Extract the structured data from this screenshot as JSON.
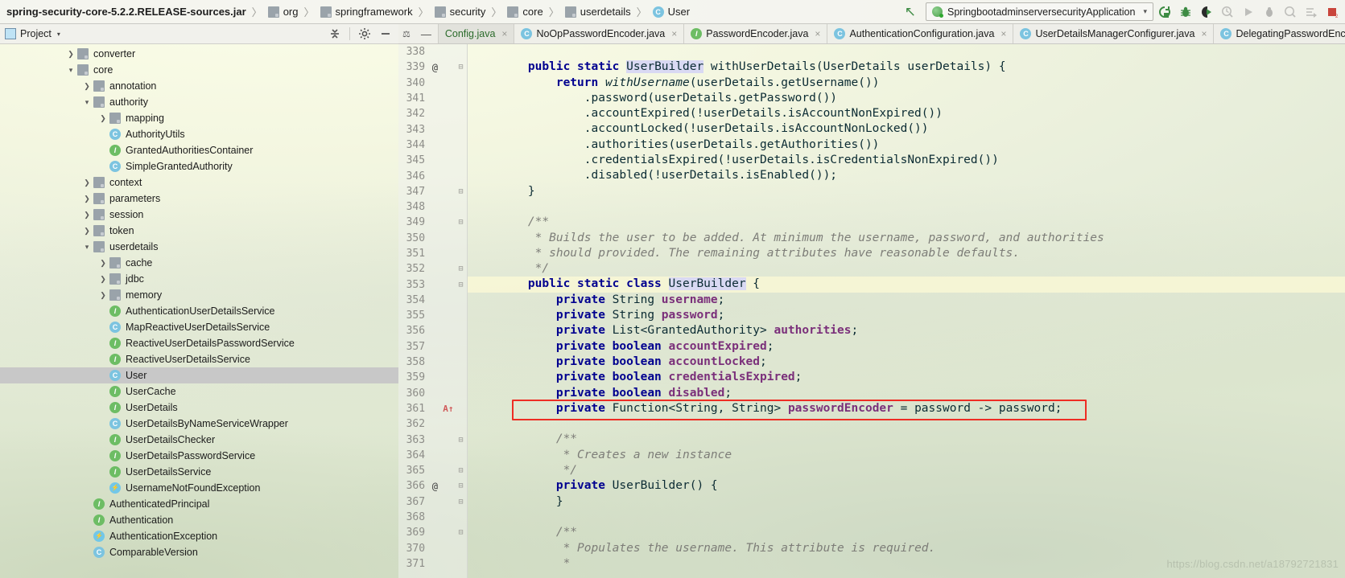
{
  "breadcrumb": {
    "root": "spring-security-core-5.2.2.RELEASE-sources.jar",
    "items": [
      {
        "label": "org",
        "icon": "folder-icon"
      },
      {
        "label": "springframework",
        "icon": "folder-icon"
      },
      {
        "label": "security",
        "icon": "folder-icon"
      },
      {
        "label": "core",
        "icon": "folder-icon"
      },
      {
        "label": "userdetails",
        "icon": "folder-icon"
      },
      {
        "label": "User",
        "icon": "class-icon"
      }
    ],
    "separator": "〉"
  },
  "toolbar": {
    "back_icon": "back-arrow-icon",
    "run_config": {
      "name": "SpringbootadminserversecurityApplication",
      "icon": "spring-boot-icon",
      "chevron": "⌄"
    },
    "buttons": [
      {
        "name": "rerun-button",
        "icon": "rerun-icon",
        "enabled": true
      },
      {
        "name": "debug-button",
        "icon": "bug-icon",
        "enabled": true
      },
      {
        "name": "run-with-coverage-button",
        "icon": "coverage-icon",
        "enabled": true
      },
      {
        "name": "profile-button",
        "icon": "profile-icon",
        "enabled": false
      },
      {
        "name": "resume-program-button",
        "icon": "play-icon",
        "enabled": false
      },
      {
        "name": "attach-debugger-button",
        "icon": "attach-icon",
        "enabled": false
      },
      {
        "name": "profiler-button",
        "icon": "profiler-icon",
        "enabled": false
      },
      {
        "name": "step-over-button",
        "icon": "step-over-icon",
        "enabled": false
      },
      {
        "name": "stop-button",
        "icon": "stop-icon",
        "enabled": true
      }
    ]
  },
  "sidebar": {
    "title": "Project",
    "title_icon": "project-view-icon",
    "title_caret": "▾",
    "collapse_all_icon": "collapse-all-icon",
    "settings_icon": "gear-icon",
    "hide_icon": "hide-icon",
    "tree": [
      {
        "label": "converter",
        "indent": 1,
        "arrow": "collapsed",
        "icon": "folder-icon",
        "selected": false
      },
      {
        "label": "core",
        "indent": 1,
        "arrow": "expanded",
        "icon": "folder-icon",
        "selected": false
      },
      {
        "label": "annotation",
        "indent": 2,
        "arrow": "collapsed",
        "icon": "folder-icon",
        "selected": false
      },
      {
        "label": "authority",
        "indent": 2,
        "arrow": "expanded",
        "icon": "folder-icon",
        "selected": false
      },
      {
        "label": "mapping",
        "indent": 3,
        "arrow": "collapsed",
        "icon": "folder-icon",
        "selected": false
      },
      {
        "label": "AuthorityUtils",
        "indent": 3,
        "arrow": "none",
        "icon": "class-icon",
        "selected": false
      },
      {
        "label": "GrantedAuthoritiesContainer",
        "indent": 3,
        "arrow": "none",
        "icon": "interface-icon",
        "selected": false
      },
      {
        "label": "SimpleGrantedAuthority",
        "indent": 3,
        "arrow": "none",
        "icon": "class-icon",
        "selected": false
      },
      {
        "label": "context",
        "indent": 2,
        "arrow": "collapsed",
        "icon": "folder-icon",
        "selected": false
      },
      {
        "label": "parameters",
        "indent": 2,
        "arrow": "collapsed",
        "icon": "folder-icon",
        "selected": false
      },
      {
        "label": "session",
        "indent": 2,
        "arrow": "collapsed",
        "icon": "folder-icon",
        "selected": false
      },
      {
        "label": "token",
        "indent": 2,
        "arrow": "collapsed",
        "icon": "folder-icon",
        "selected": false
      },
      {
        "label": "userdetails",
        "indent": 2,
        "arrow": "expanded",
        "icon": "folder-icon",
        "selected": false
      },
      {
        "label": "cache",
        "indent": 3,
        "arrow": "collapsed",
        "icon": "folder-icon",
        "selected": false
      },
      {
        "label": "jdbc",
        "indent": 3,
        "arrow": "collapsed",
        "icon": "folder-icon",
        "selected": false
      },
      {
        "label": "memory",
        "indent": 3,
        "arrow": "collapsed",
        "icon": "folder-icon",
        "selected": false
      },
      {
        "label": "AuthenticationUserDetailsService",
        "indent": 3,
        "arrow": "none",
        "icon": "interface-icon",
        "selected": false
      },
      {
        "label": "MapReactiveUserDetailsService",
        "indent": 3,
        "arrow": "none",
        "icon": "class-icon",
        "selected": false
      },
      {
        "label": "ReactiveUserDetailsPasswordService",
        "indent": 3,
        "arrow": "none",
        "icon": "interface-icon",
        "selected": false
      },
      {
        "label": "ReactiveUserDetailsService",
        "indent": 3,
        "arrow": "none",
        "icon": "interface-icon",
        "selected": false
      },
      {
        "label": "User",
        "indent": 3,
        "arrow": "none",
        "icon": "class-icon",
        "selected": true
      },
      {
        "label": "UserCache",
        "indent": 3,
        "arrow": "none",
        "icon": "interface-icon",
        "selected": false
      },
      {
        "label": "UserDetails",
        "indent": 3,
        "arrow": "none",
        "icon": "interface-icon",
        "selected": false
      },
      {
        "label": "UserDetailsByNameServiceWrapper",
        "indent": 3,
        "arrow": "none",
        "icon": "class-icon",
        "selected": false
      },
      {
        "label": "UserDetailsChecker",
        "indent": 3,
        "arrow": "none",
        "icon": "interface-icon",
        "selected": false
      },
      {
        "label": "UserDetailsPasswordService",
        "indent": 3,
        "arrow": "none",
        "icon": "interface-icon",
        "selected": false
      },
      {
        "label": "UserDetailsService",
        "indent": 3,
        "arrow": "none",
        "icon": "interface-icon",
        "selected": false
      },
      {
        "label": "UsernameNotFoundException",
        "indent": 3,
        "arrow": "none",
        "icon": "exception-icon",
        "selected": false
      },
      {
        "label": "AuthenticatedPrincipal",
        "indent": 2,
        "arrow": "none",
        "icon": "interface-icon",
        "selected": false
      },
      {
        "label": "Authentication",
        "indent": 2,
        "arrow": "none",
        "icon": "interface-icon",
        "selected": false
      },
      {
        "label": "AuthenticationException",
        "indent": 2,
        "arrow": "none",
        "icon": "exception-icon",
        "selected": false
      },
      {
        "label": "ComparableVersion",
        "indent": 2,
        "arrow": "none",
        "icon": "class-icon",
        "selected": false
      }
    ]
  },
  "tabs": {
    "pin_icon": "pin-icon",
    "minimize_icon": "—",
    "items": [
      {
        "label": "Config.java",
        "icon": "none",
        "active": true,
        "close": "×"
      },
      {
        "label": "NoOpPasswordEncoder.java",
        "icon": "class-icon",
        "active": false,
        "close": "×"
      },
      {
        "label": "PasswordEncoder.java",
        "icon": "interface-icon",
        "active": false,
        "close": "×"
      },
      {
        "label": "AuthenticationConfiguration.java",
        "icon": "class-icon",
        "active": false,
        "close": "×"
      },
      {
        "label": "UserDetailsManagerConfigurer.java",
        "icon": "class-icon",
        "active": false,
        "close": "×"
      },
      {
        "label": "DelegatingPasswordEncoder.java",
        "icon": "class-icon",
        "active": false,
        "close": "×"
      }
    ]
  },
  "editor": {
    "first_visible_line": 338,
    "lines": [
      {
        "num": 338,
        "at": "",
        "warn": "",
        "fold": "",
        "highlight": false,
        "partial": true,
        "html": ""
      },
      {
        "num": 339,
        "at": "@",
        "warn": "",
        "fold": "-",
        "highlight": false,
        "html": "    <span class='kw'>public static</span> <span class='sel'>UserBuilder</span> withUserDetails(UserDetails userDetails) {"
      },
      {
        "num": 340,
        "at": "",
        "warn": "",
        "fold": "",
        "highlight": false,
        "html": "        <span class='kw'>return</span> <span class='mth'>withUsername</span>(userDetails.getUsername())"
      },
      {
        "num": 341,
        "at": "",
        "warn": "",
        "fold": "",
        "highlight": false,
        "html": "            .password(userDetails.getPassword())"
      },
      {
        "num": 342,
        "at": "",
        "warn": "",
        "fold": "",
        "highlight": false,
        "html": "            .accountExpired(!userDetails.isAccountNonExpired())"
      },
      {
        "num": 343,
        "at": "",
        "warn": "",
        "fold": "",
        "highlight": false,
        "html": "            .accountLocked(!userDetails.isAccountNonLocked())"
      },
      {
        "num": 344,
        "at": "",
        "warn": "",
        "fold": "",
        "highlight": false,
        "html": "            .authorities(userDetails.getAuthorities())"
      },
      {
        "num": 345,
        "at": "",
        "warn": "",
        "fold": "",
        "highlight": false,
        "html": "            .credentialsExpired(!userDetails.isCredentialsNonExpired())"
      },
      {
        "num": 346,
        "at": "",
        "warn": "",
        "fold": "",
        "highlight": false,
        "html": "            .disabled(!userDetails.isEnabled());"
      },
      {
        "num": 347,
        "at": "",
        "warn": "",
        "fold": "-",
        "highlight": false,
        "html": "    }"
      },
      {
        "num": 348,
        "at": "",
        "warn": "",
        "fold": "",
        "highlight": false,
        "html": ""
      },
      {
        "num": 349,
        "at": "",
        "warn": "",
        "fold": "-",
        "highlight": false,
        "html": "    <span class='cmt'>/**</span>"
      },
      {
        "num": 350,
        "at": "",
        "warn": "",
        "fold": "",
        "highlight": false,
        "html": "     <span class='cmt'>* Builds the user to be added. At minimum the username, password, and authorities</span>"
      },
      {
        "num": 351,
        "at": "",
        "warn": "",
        "fold": "",
        "highlight": false,
        "html": "     <span class='cmt'>* should provided. The remaining attributes have reasonable defaults.</span>"
      },
      {
        "num": 352,
        "at": "",
        "warn": "",
        "fold": "-",
        "highlight": false,
        "html": "     <span class='cmt'>*/</span>"
      },
      {
        "num": 353,
        "at": "",
        "warn": "",
        "fold": "-",
        "highlight": true,
        "html": "    <span class='kw'>public static class</span> <span class='sel'>UserBuilder</span> {"
      },
      {
        "num": 354,
        "at": "",
        "warn": "",
        "fold": "",
        "highlight": false,
        "html": "        <span class='kw'>private</span> String <span class='fld'>username</span>;"
      },
      {
        "num": 355,
        "at": "",
        "warn": "",
        "fold": "",
        "highlight": false,
        "html": "        <span class='kw'>private</span> String <span class='fld'>password</span>;"
      },
      {
        "num": 356,
        "at": "",
        "warn": "",
        "fold": "",
        "highlight": false,
        "html": "        <span class='kw'>private</span> List&lt;GrantedAuthority&gt; <span class='fld'>authorities</span>;"
      },
      {
        "num": 357,
        "at": "",
        "warn": "",
        "fold": "",
        "highlight": false,
        "html": "        <span class='kw'>private boolean</span> <span class='fld'>accountExpired</span>;"
      },
      {
        "num": 358,
        "at": "",
        "warn": "",
        "fold": "",
        "highlight": false,
        "html": "        <span class='kw'>private boolean</span> <span class='fld'>accountLocked</span>;"
      },
      {
        "num": 359,
        "at": "",
        "warn": "",
        "fold": "",
        "highlight": false,
        "html": "        <span class='kw'>private boolean</span> <span class='fld'>credentialsExpired</span>;"
      },
      {
        "num": 360,
        "at": "",
        "warn": "",
        "fold": "",
        "highlight": false,
        "html": "        <span class='kw'>private boolean</span> <span class='fld'>disabled</span>;"
      },
      {
        "num": 361,
        "at": "",
        "warn": "↑",
        "fold": "",
        "highlight": false,
        "html": "        <span class='kw'>private</span> Function&lt;String, String&gt; <span class='fld'>passwordEncoder</span> = password -&gt; password;"
      },
      {
        "num": 362,
        "at": "",
        "warn": "",
        "fold": "",
        "highlight": false,
        "html": ""
      },
      {
        "num": 363,
        "at": "",
        "warn": "",
        "fold": "-",
        "highlight": false,
        "html": "        <span class='cmt'>/**</span>"
      },
      {
        "num": 364,
        "at": "",
        "warn": "",
        "fold": "",
        "highlight": false,
        "html": "         <span class='cmt'>* Creates a new instance</span>"
      },
      {
        "num": 365,
        "at": "",
        "warn": "",
        "fold": "-",
        "highlight": false,
        "html": "         <span class='cmt'>*/</span>"
      },
      {
        "num": 366,
        "at": "@",
        "warn": "",
        "fold": "-",
        "highlight": false,
        "html": "        <span class='kw'>private</span> UserBuilder() {"
      },
      {
        "num": 367,
        "at": "",
        "warn": "",
        "fold": "-",
        "highlight": false,
        "html": "        }"
      },
      {
        "num": 368,
        "at": "",
        "warn": "",
        "fold": "",
        "highlight": false,
        "html": ""
      },
      {
        "num": 369,
        "at": "",
        "warn": "",
        "fold": "-",
        "highlight": false,
        "html": "        <span class='cmt'>/**</span>"
      },
      {
        "num": 370,
        "at": "",
        "warn": "",
        "fold": "",
        "highlight": false,
        "html": "         <span class='cmt'>* Populates the username. This attribute is required.</span>"
      },
      {
        "num": 371,
        "at": "",
        "warn": "",
        "fold": "",
        "highlight": false,
        "html": "         <span class='cmt'>*</span>"
      }
    ],
    "annotation_box": {
      "label": "passwordEncoder-highlight-box",
      "color": "#ee2d24"
    }
  },
  "watermark": "https://blog.csdn.net/a18792721831",
  "colors": {
    "accent_green": "#3d8b43",
    "keyword_blue": "#00008f",
    "field_purple": "#7a2f7a",
    "comment_gray": "#7d7d78",
    "highlight_red": "#ee2d24",
    "selection_lavender": "#d9d9f3"
  }
}
